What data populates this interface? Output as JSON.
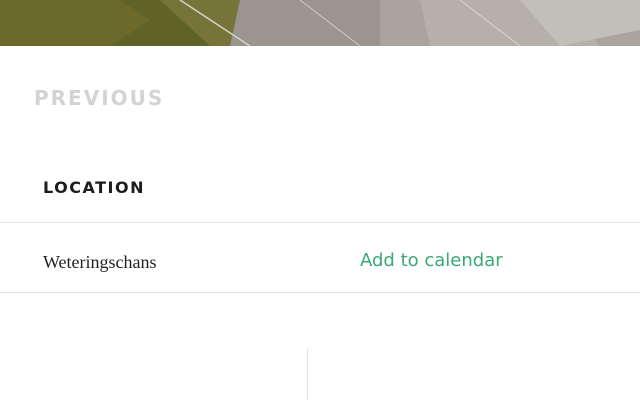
{
  "hero": {
    "image": "landscape-photo-cropped"
  },
  "navigation": {
    "previous_label": "PREVIOUS"
  },
  "details": {
    "location_heading": "LOCATION",
    "location_value": "Weteringschans",
    "calendar_link": "Add to calendar"
  },
  "colors": {
    "accent_link": "#3aa877",
    "muted_nav": "#d3d3d3",
    "divider": "#e3e3e3"
  }
}
